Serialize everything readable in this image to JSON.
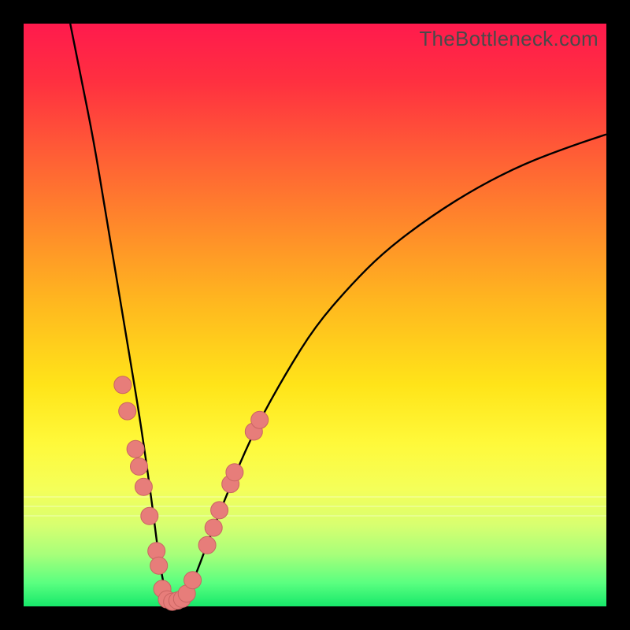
{
  "watermark": "TheBottleneck.com",
  "colors": {
    "frame": "#000000",
    "curve": "#000000",
    "marker_fill": "#e77d7a",
    "marker_stroke": "#c96462"
  },
  "chart_data": {
    "type": "line",
    "title": "",
    "xlabel": "",
    "ylabel": "",
    "xlim": [
      0,
      100
    ],
    "ylim": [
      0,
      100
    ],
    "grid": false,
    "legend": false,
    "annotations": [
      "TheBottleneck.com"
    ],
    "note": "V-shaped bottleneck curve. Y ≈ bottleneck %, X ≈ component relative performance. Values estimated from pixel positions; no axis ticks shown in image.",
    "series": [
      {
        "name": "bottleneck-curve",
        "x": [
          8,
          10,
          12,
          14,
          16,
          18,
          20,
          22,
          23.5,
          25,
          27,
          29,
          32,
          36,
          40,
          45,
          50,
          56,
          62,
          70,
          78,
          86,
          94,
          100
        ],
        "y": [
          100,
          90,
          80,
          68,
          56,
          44,
          32,
          18,
          6,
          0,
          0,
          4,
          12,
          22,
          31,
          40,
          48,
          55,
          61,
          67,
          72,
          76,
          79,
          81
        ]
      }
    ],
    "markers": [
      {
        "x": 17.0,
        "y": 38.0
      },
      {
        "x": 17.8,
        "y": 33.5
      },
      {
        "x": 19.2,
        "y": 27.0
      },
      {
        "x": 19.8,
        "y": 24.0
      },
      {
        "x": 20.6,
        "y": 20.5
      },
      {
        "x": 21.6,
        "y": 15.5
      },
      {
        "x": 22.8,
        "y": 9.5
      },
      {
        "x": 23.2,
        "y": 7.0
      },
      {
        "x": 23.8,
        "y": 3.0
      },
      {
        "x": 24.6,
        "y": 1.2
      },
      {
        "x": 25.5,
        "y": 0.8
      },
      {
        "x": 26.4,
        "y": 1.0
      },
      {
        "x": 27.2,
        "y": 1.3
      },
      {
        "x": 28.0,
        "y": 2.2
      },
      {
        "x": 29.0,
        "y": 4.5
      },
      {
        "x": 31.5,
        "y": 10.5
      },
      {
        "x": 32.6,
        "y": 13.5
      },
      {
        "x": 33.6,
        "y": 16.5
      },
      {
        "x": 35.5,
        "y": 21.0
      },
      {
        "x": 36.2,
        "y": 23.0
      },
      {
        "x": 39.5,
        "y": 30.0
      },
      {
        "x": 40.5,
        "y": 32.0
      }
    ]
  }
}
